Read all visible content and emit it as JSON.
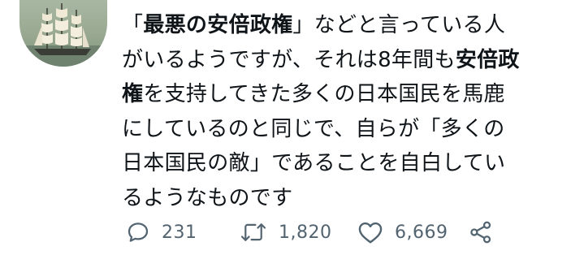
{
  "tweet": {
    "lines": [
      {
        "pre": "「",
        "bold": "最悪の安倍政権",
        "post": "」などと言っている人"
      },
      {
        "pre": "がいるようですが、それは8年間も",
        "bold": "安倍政",
        "post": ""
      },
      {
        "pre": "",
        "bold": "権",
        "post": "を支持してきた多くの日本国民を馬鹿"
      },
      {
        "pre": "にしているのと同じで、自らが「多くの",
        "bold": "",
        "post": ""
      },
      {
        "pre": "日本国民の敵」であることを自白してい",
        "bold": "",
        "post": ""
      },
      {
        "pre": "るようなものです",
        "bold": "",
        "post": ""
      }
    ]
  },
  "actions": {
    "reply": {
      "icon": "reply-icon",
      "count": "231"
    },
    "retweet": {
      "icon": "retweet-icon",
      "count": "1,820"
    },
    "like": {
      "icon": "heart-icon",
      "count": "6,669"
    },
    "share": {
      "icon": "share-icon"
    }
  },
  "colors": {
    "text": "#0f1419",
    "icon": "#536471",
    "avatar_bg": "#9fb09a"
  }
}
